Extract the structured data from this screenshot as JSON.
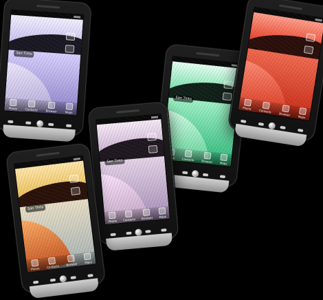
{
  "photo": {
    "phones": [
      {
        "tint": "lilac",
        "widget_label": "San Tinto",
        "dock_labels": [
          "Phone",
          "Contacts",
          "Browser",
          "Maps"
        ]
      },
      {
        "tint": "green",
        "widget_label": "San Tinto",
        "dock_labels": [
          "Phone",
          "Contacts",
          "Browser",
          "Maps"
        ]
      },
      {
        "tint": "red",
        "widget_label": "",
        "dock_labels": [
          "Phone",
          "Contacts",
          "Browser",
          "Maps"
        ]
      },
      {
        "tint": "mauve",
        "widget_label": "San Tinto",
        "dock_labels": [
          "Phone",
          "Contacts",
          "Browser",
          "Maps"
        ]
      },
      {
        "tint": "gold",
        "widget_label": "San Tinto",
        "dock_labels": [
          "Phone",
          "Contacts",
          "Browser",
          "Maps"
        ]
      }
    ],
    "colors": {
      "background": "#000000",
      "lilac": "#c8bff0",
      "green": "#2cb87a",
      "red": "#ea3e24",
      "mauve": "#c9b2d2",
      "gold": "#ebbe55"
    }
  }
}
